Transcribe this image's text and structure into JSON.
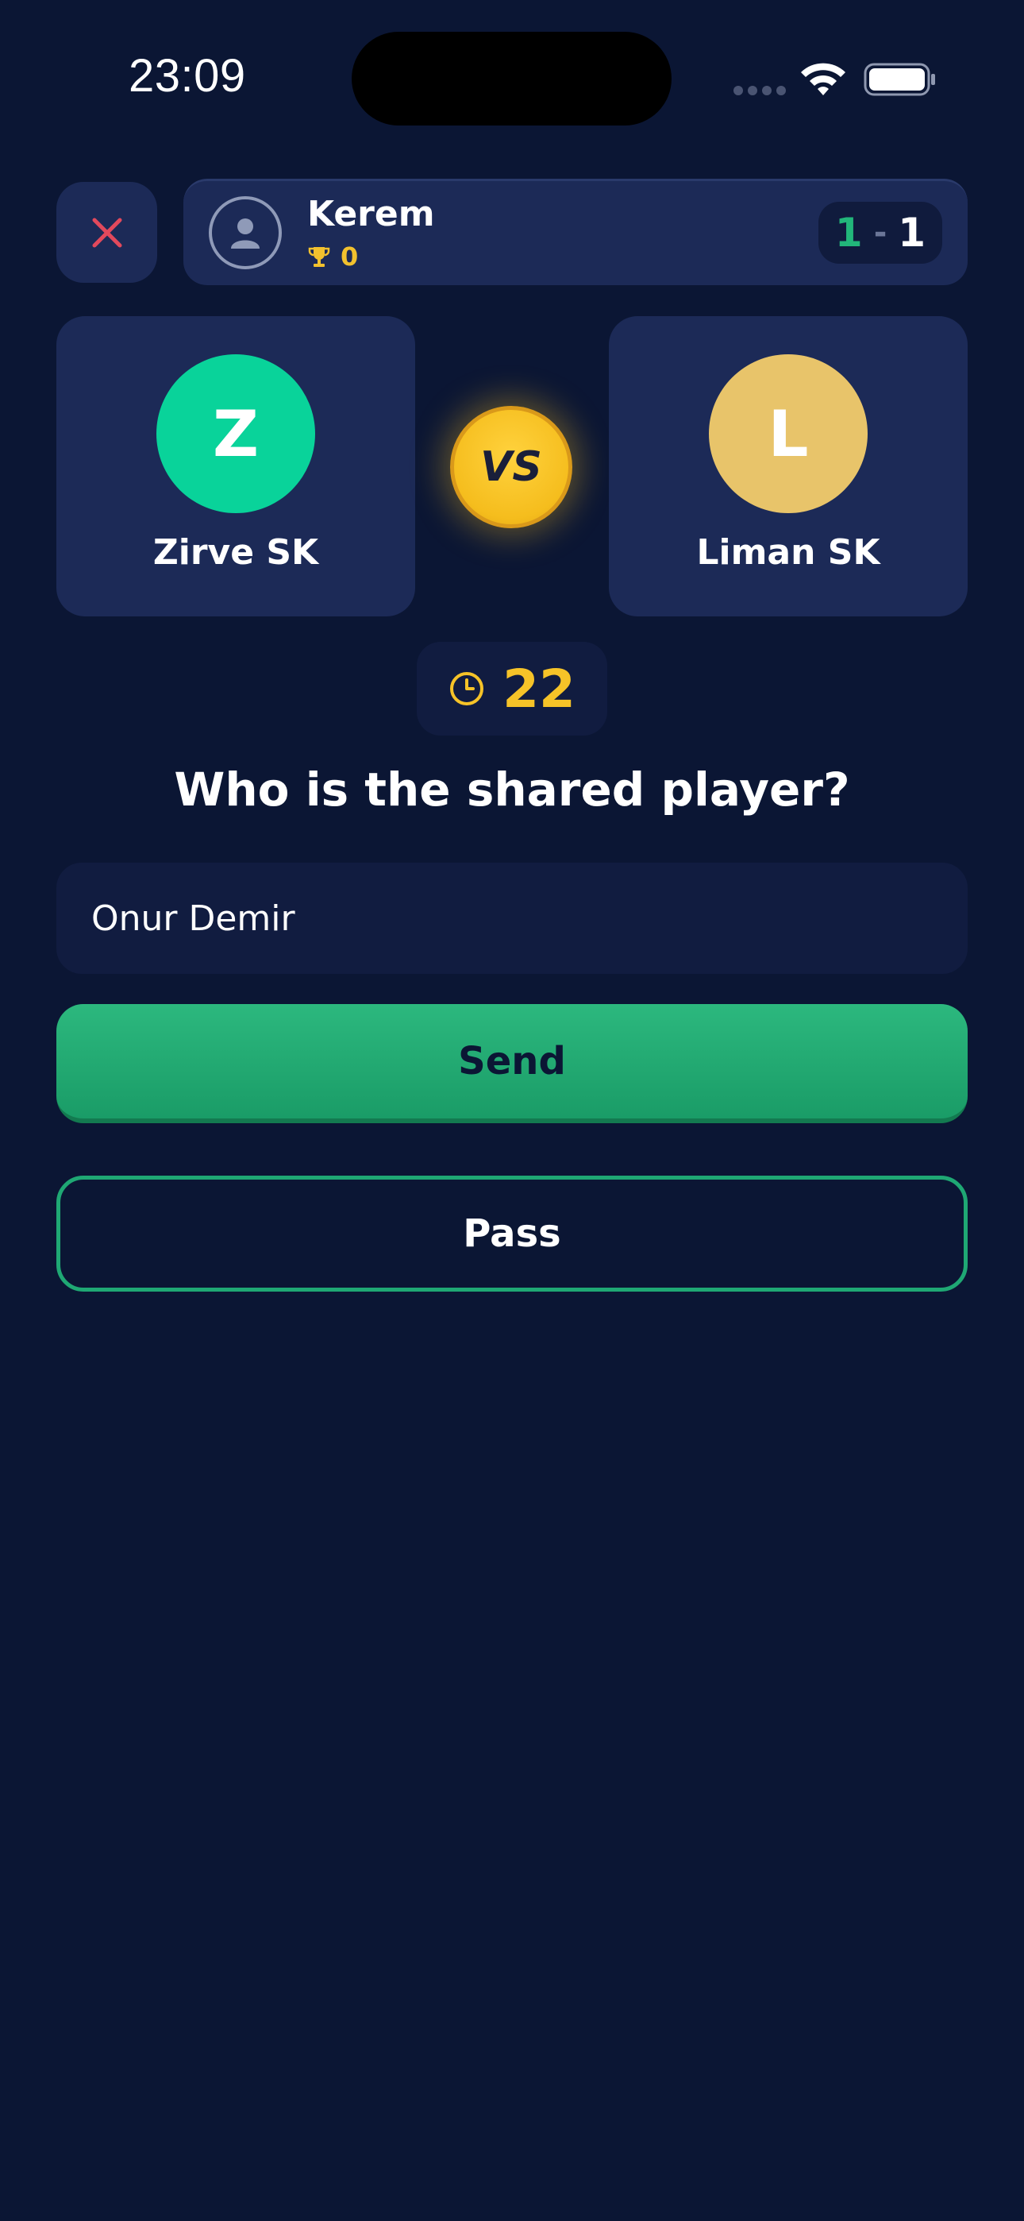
{
  "status_bar": {
    "time": "23:09"
  },
  "header": {
    "close_icon": "close-icon",
    "player": {
      "name": "Kerem",
      "trophies": "0"
    },
    "score": {
      "left": "1",
      "separator": "-",
      "right": "1"
    }
  },
  "match": {
    "home": {
      "initial": "Z",
      "name": "Zirve SK",
      "color": "#09d39a"
    },
    "vs_label": "VS",
    "away": {
      "initial": "L",
      "name": "Liman SK",
      "color": "#e8c46a"
    }
  },
  "timer": {
    "seconds": "22"
  },
  "question": "Who is the shared player?",
  "answer": {
    "value": "Onur Demir"
  },
  "actions": {
    "send_label": "Send",
    "pass_label": "Pass"
  },
  "colors": {
    "background": "#0b1634",
    "card": "#1c2a57",
    "accent_green": "#22b67a",
    "accent_gold": "#f6c328",
    "close_red": "#e2495c"
  }
}
